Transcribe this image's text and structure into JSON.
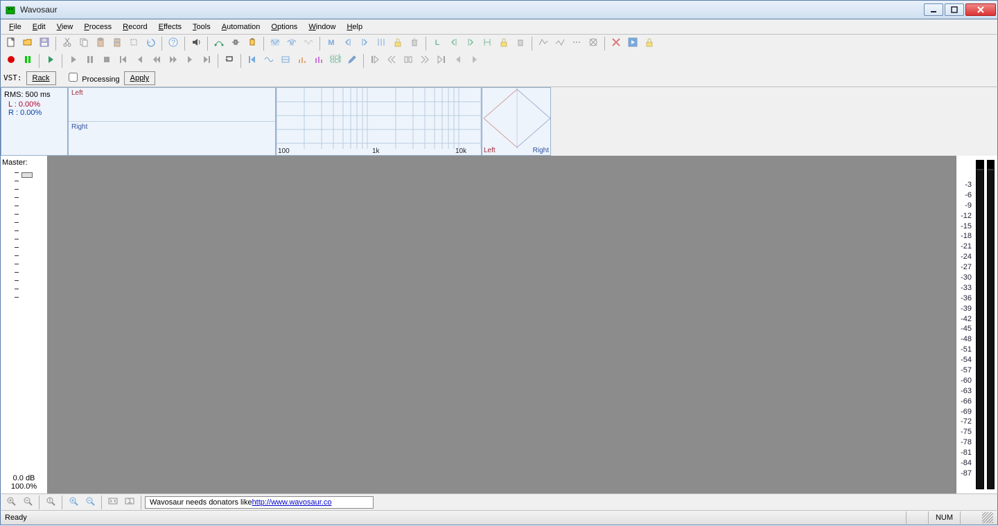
{
  "titlebar": {
    "title": "Wavosaur"
  },
  "menu": {
    "items": [
      "File",
      "Edit",
      "View",
      "Process",
      "Record",
      "Effects",
      "Tools",
      "Automation",
      "Options",
      "Window",
      "Help"
    ]
  },
  "toolbars": {
    "row1_icons": [
      "new-icon",
      "open-icon",
      "save-icon",
      "sep",
      "cut-icon",
      "copy-icon",
      "paste-icon",
      "paste-mix-icon",
      "crop-icon",
      "undo-icon",
      "sep",
      "help-icon",
      "sep",
      "speaker-icon",
      "sep",
      "route-icon",
      "connector-icon",
      "plug-icon",
      "sep",
      "select-all-wave-icon",
      "trim-wave-icon",
      "fade-wave-icon",
      "sep",
      "marker-m-icon",
      "marker-back-icon",
      "marker-fwd-icon",
      "marker-auto-icon",
      "lock-yellow-icon",
      "trash-icon",
      "sep",
      "loop-l-icon",
      "loop-back-icon",
      "loop-fwd-icon",
      "loop-auto-icon",
      "lock-yellow2-icon",
      "trash2-icon",
      "sep",
      "wave-env-icon",
      "wave-line-icon",
      "wave-dots-icon",
      "wave-x-icon",
      "sep",
      "cancel-x-icon",
      "play-box-icon",
      "lock3-icon"
    ],
    "row2_icons": [
      "record-icon",
      "vu-icon",
      "sep",
      "play-icon",
      "sep",
      "play2-icon",
      "pause-icon",
      "stop-icon",
      "prev-track-icon",
      "prev-icon",
      "rew-icon",
      "ffwd-icon",
      "next-icon",
      "next-track-icon",
      "sep",
      "repeat-icon",
      "sep",
      "goto-start-icon",
      "wave-tool-icon",
      "region-icon",
      "bars-icon",
      "bars2-icon",
      "kick-icon",
      "pencil-icon",
      "sep",
      "skipback-icon",
      "skipback2-icon",
      "splitblock-icon",
      "skipfwd2-icon",
      "skipfwd-icon",
      "tri-left-icon",
      "tri-right-icon"
    ],
    "row3": {
      "vst_label": "VST:",
      "rack_label": "Rack",
      "processing_label": "Processing",
      "apply_label": "Apply"
    }
  },
  "panels": {
    "rms": {
      "title": "RMS: 500 ms",
      "l": "L : 0.00%",
      "r": "R : 0.00%"
    },
    "wave": {
      "left_label": "Left",
      "right_label": "Right"
    },
    "spectrum": {
      "labels": [
        "100",
        "1k",
        "10k"
      ]
    },
    "phase": {
      "left": "Left",
      "right": "Right"
    }
  },
  "master": {
    "label": "Master:",
    "db": "0.0 dB",
    "pct": "100.0%"
  },
  "meter": {
    "scale": [
      "-3",
      "-6",
      "-9",
      "-12",
      "-15",
      "-18",
      "-21",
      "-24",
      "-27",
      "-30",
      "-33",
      "-36",
      "-39",
      "-42",
      "-45",
      "-48",
      "-51",
      "-54",
      "-57",
      "-60",
      "-63",
      "-66",
      "-69",
      "-72",
      "-75",
      "-78",
      "-81",
      "-84",
      "-87"
    ]
  },
  "zoom": {
    "icons": [
      "zoom-in-icon",
      "zoom-out-icon",
      "sep",
      "zoom-v-icon",
      "sep",
      "zoom-sel-in-icon",
      "zoom-sel-out-icon",
      "sep",
      "zoom-full-icon",
      "zoom-one-icon",
      "sep"
    ],
    "link_pre": "Wavosaur needs donators like   ",
    "link": "http://www.wavosaur.co"
  },
  "status": {
    "ready": "Ready",
    "num": "NUM"
  }
}
